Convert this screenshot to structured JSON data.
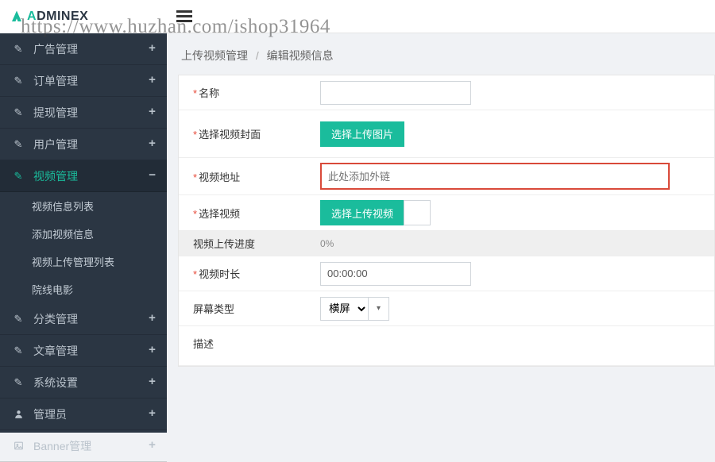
{
  "brand": {
    "prefix": "A",
    "name": "DMINEX"
  },
  "watermark": "https://www.huzhan.com/ishop31964",
  "nav": {
    "items": [
      {
        "label": "广告管理",
        "icon": "edit"
      },
      {
        "label": "订单管理",
        "icon": "edit"
      },
      {
        "label": "提现管理",
        "icon": "edit"
      },
      {
        "label": "用户管理",
        "icon": "edit"
      },
      {
        "label": "视频管理",
        "icon": "edit",
        "active": true,
        "children": [
          "视频信息列表",
          "添加视频信息",
          "视频上传管理列表",
          "院线电影"
        ]
      },
      {
        "label": "分类管理",
        "icon": "edit"
      },
      {
        "label": "文章管理",
        "icon": "edit"
      },
      {
        "label": "系统设置",
        "icon": "edit"
      },
      {
        "label": "管理员",
        "icon": "user"
      },
      {
        "label": "Banner管理",
        "icon": "image"
      }
    ]
  },
  "breadcrumb": {
    "a": "上传视频管理",
    "b": "编辑视频信息"
  },
  "form": {
    "name_label": "名称",
    "name_value": "",
    "cover_label": "选择视频封面",
    "cover_btn": "选择上传图片",
    "url_label": "视频地址",
    "url_placeholder": "此处添加外链",
    "video_label": "选择视频",
    "video_btn": "选择上传视频",
    "progress_label": "视频上传进度",
    "progress_value": "0%",
    "duration_label": "视频时长",
    "duration_value": "00:00:00",
    "screen_label": "屏幕类型",
    "screen_value": "横屏",
    "desc_label": "描述"
  }
}
